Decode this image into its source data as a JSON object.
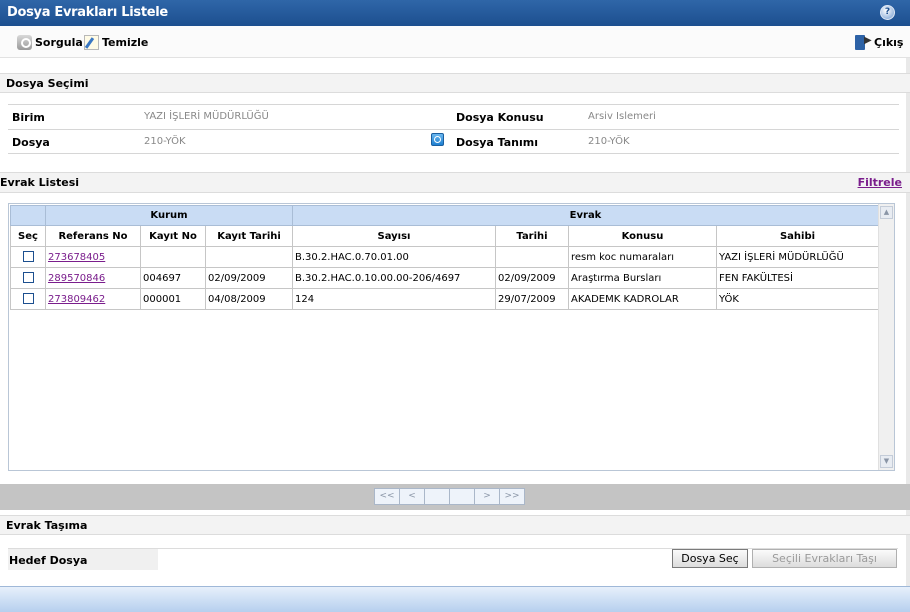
{
  "window": {
    "title": "Dosya Evrakları Listele",
    "help_icon": "help-icon"
  },
  "toolbar": {
    "query_label": "Sorgula",
    "clear_label": "Temizle",
    "exit_label": "Çıkış"
  },
  "file_selection": {
    "section_title": "Dosya Seçimi",
    "birim_label": "Birim",
    "birim_value": "YAZI İŞLERİ MÜDÜRLÜĞÜ",
    "dosya_label": "Dosya",
    "dosya_value": "210-YÖK",
    "konu_label": "Dosya Konusu",
    "konu_value": "Arsiv Islemeri",
    "tanim_label": "Dosya Tanımı",
    "tanim_value": "210-YÖK"
  },
  "doc_list": {
    "section_title": "Evrak Listesi",
    "filter_label": "Filtrele",
    "group_headers": {
      "kurum": "Kurum",
      "evrak": "Evrak"
    },
    "columns": [
      "Seç",
      "Referans No",
      "Kayıt No",
      "Kayıt Tarihi",
      "Sayısı",
      "Tarihi",
      "Konusu",
      "Sahibi"
    ],
    "rows": [
      {
        "ref": "273678405",
        "kayit_no": "",
        "kayit_tarihi": "",
        "sayisi": "B.30.2.HAC.0.70.01.00",
        "tarihi": "",
        "konusu": "resm koc numaraları",
        "sahibi": "YAZI İŞLERİ MÜDÜRLÜĞÜ"
      },
      {
        "ref": "289570846",
        "kayit_no": "004697",
        "kayit_tarihi": "02/09/2009",
        "sayisi": "B.30.2.HAC.0.10.00.00-206/4697",
        "tarihi": "02/09/2009",
        "konusu": "Araştırma Bursları",
        "sahibi": "FEN FAKÜLTESİ"
      },
      {
        "ref": "273809462",
        "kayit_no": "000001",
        "kayit_tarihi": "04/08/2009",
        "sayisi": "124",
        "tarihi": "29/07/2009",
        "konusu": "AKADEMK KADROLAR",
        "sahibi": "YÖK"
      }
    ]
  },
  "pager": {
    "first": "<<",
    "prev": "<",
    "next": ">",
    "last": ">>"
  },
  "transfer": {
    "section_title": "Evrak Taşıma",
    "target_label": "Hedef Dosya",
    "select_button": "Dosya Seç",
    "move_button": "Seçili Evrakları Taşı"
  },
  "colors": {
    "title_bar": "#1c4f8f",
    "grid_header": "#c9dcf4",
    "link": "#7a1d8c"
  }
}
